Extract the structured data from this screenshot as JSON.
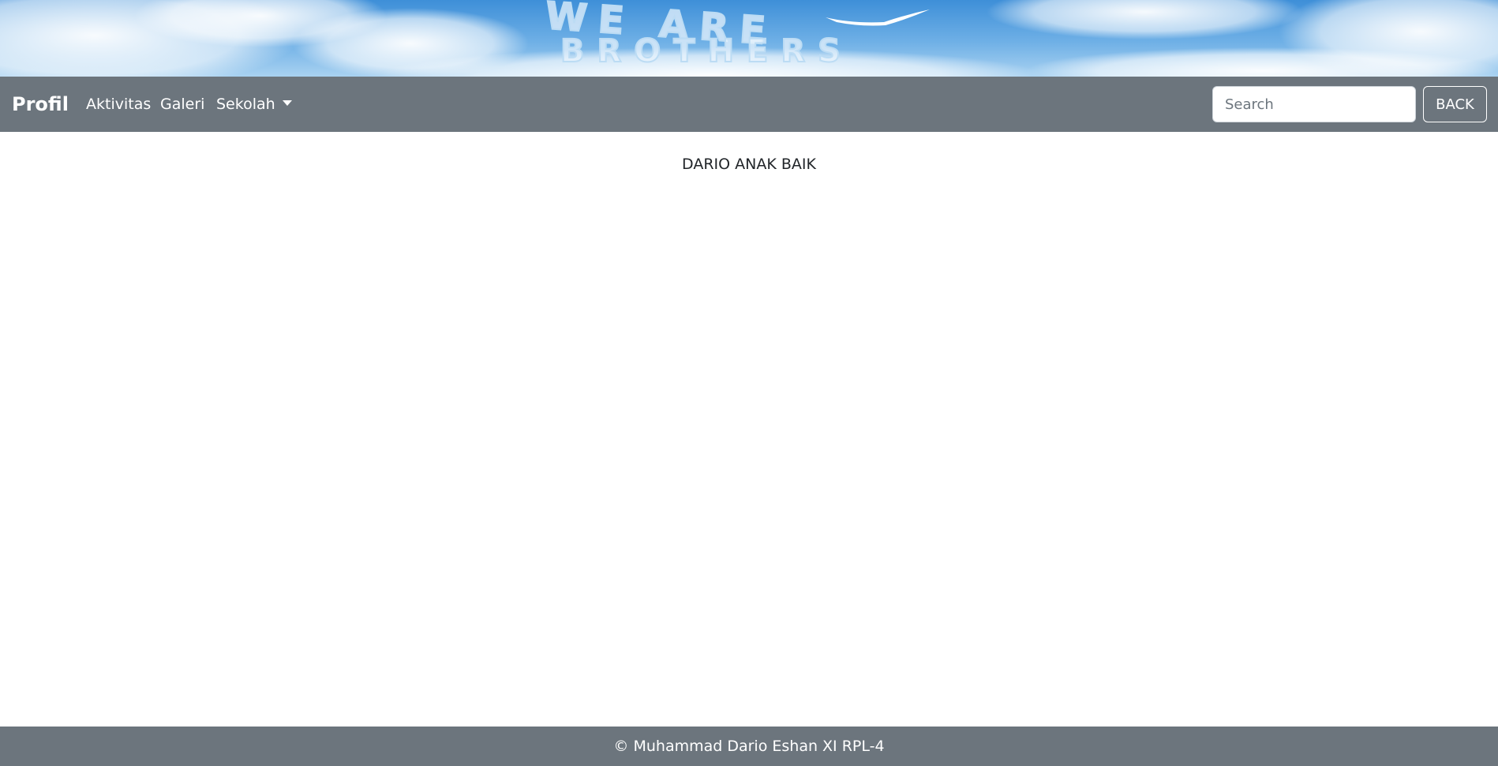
{
  "banner": {
    "image_text_line1": "WE ARE",
    "image_text_line2": "BROTHERS"
  },
  "navbar": {
    "brand": "Profil",
    "links": [
      {
        "label": "Aktivitas"
      },
      {
        "label": "Galeri"
      },
      {
        "label": "Sekolah",
        "dropdown": true
      }
    ],
    "search": {
      "placeholder": "Search",
      "value": ""
    },
    "back_label": "BACK",
    "background_color": "#6c757d"
  },
  "main": {
    "text": "DARIO ANAK BAIK"
  },
  "footer": {
    "text": "© Muhammad Dario Eshan XI RPL-4"
  }
}
